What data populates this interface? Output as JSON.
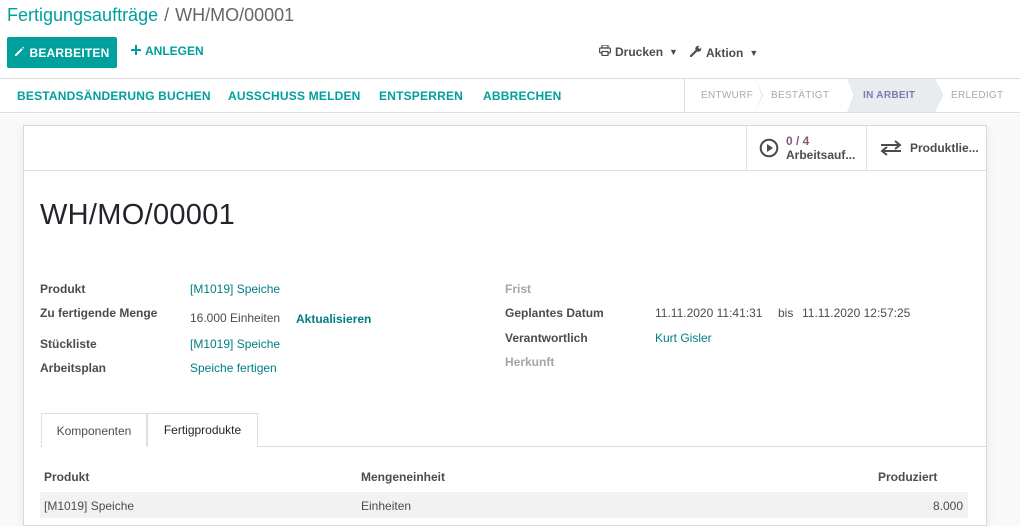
{
  "breadcrumb": {
    "parent": "Fertigungsaufträge",
    "separator": "/",
    "current": "WH/MO/00001"
  },
  "toolbar": {
    "edit_label": "BEARBEITEN",
    "create_label": "ANLEGEN",
    "print_label": "Drucken",
    "action_label": "Aktion"
  },
  "statusbar": {
    "buttons": [
      "BESTANDSÄNDERUNG BUCHEN",
      "AUSSCHUSS MELDEN",
      "ENTSPERREN",
      "ABBRECHEN"
    ],
    "stages": [
      "ENTWURF",
      "BESTÄTIGT",
      "IN ARBEIT",
      "ERLEDIGT"
    ],
    "active_stage": "IN ARBEIT"
  },
  "smart_buttons": [
    {
      "value": "0 / 4",
      "label": "Arbeitsauf...",
      "icon": "play-circle-icon"
    },
    {
      "label": "Produktlie...",
      "icon": "exchange-arrows-icon"
    }
  ],
  "form": {
    "title": "WH/MO/00001",
    "left": {
      "product_label": "Produkt",
      "product_value": "[M1019] Speiche",
      "qty_label": "Zu fertigende Menge",
      "qty_value": "16.000 Einheiten",
      "qty_update": "Aktualisieren",
      "bom_label": "Stückliste",
      "bom_value": "[M1019] Speiche",
      "routing_label": "Arbeitsplan",
      "routing_value": "Speiche fertigen"
    },
    "right": {
      "deadline_label": "Frist",
      "planned_label": "Geplantes Datum",
      "planned_start": "11.11.2020 11:41:31",
      "planned_to": "bis",
      "planned_end": "11.11.2020 12:57:25",
      "responsible_label": "Verantwortlich",
      "responsible_value": "Kurt Gisler",
      "origin_label": "Herkunft"
    }
  },
  "notebook": {
    "tabs": [
      "Komponenten",
      "Fertigprodukte"
    ],
    "active_tab": "Fertigprodukte",
    "table": {
      "headers": [
        "Produkt",
        "Mengeneinheit",
        "Produziert"
      ],
      "rows": [
        [
          "[M1019] Speiche",
          "Einheiten",
          "8.000"
        ]
      ]
    }
  },
  "colors": {
    "brand": "#00a09d",
    "link": "#017e84",
    "active_stage": "#7c7bad",
    "smart_value": "#875a7b"
  }
}
